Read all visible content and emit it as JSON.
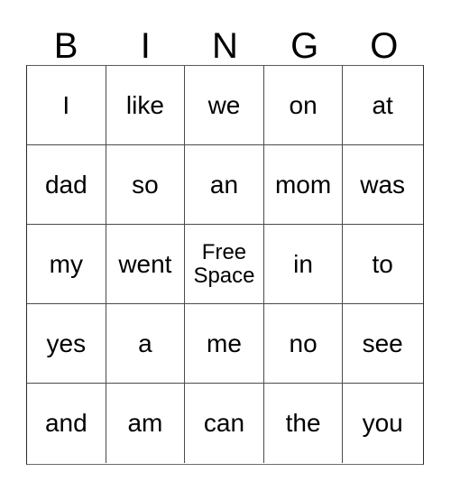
{
  "card": {
    "title": "BINGO",
    "header_letters": [
      "B",
      "I",
      "N",
      "G",
      "O"
    ],
    "rows": [
      [
        "I",
        "like",
        "we",
        "on",
        "at"
      ],
      [
        "dad",
        "so",
        "an",
        "mom",
        "was"
      ],
      [
        "my",
        "went",
        "Free Space",
        "in",
        "to"
      ],
      [
        "yes",
        "a",
        "me",
        "no",
        "see"
      ],
      [
        "and",
        "am",
        "can",
        "the",
        "you"
      ]
    ],
    "free_space_label": "Free Space",
    "free_space_position": {
      "row": 2,
      "col": 2
    },
    "grid_size": {
      "rows": 5,
      "cols": 5
    },
    "colors": {
      "background": "#ffffff",
      "text": "#000000",
      "grid_line": "#4b4b4b",
      "outer_border": "#2b2b2b"
    }
  }
}
